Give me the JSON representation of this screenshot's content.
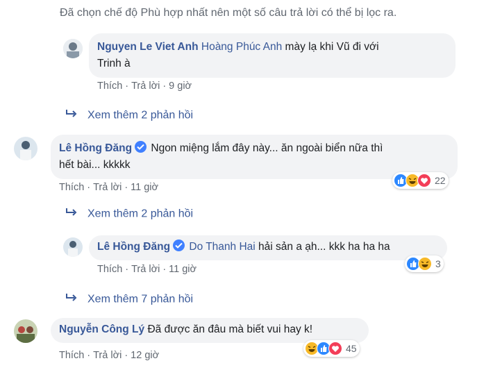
{
  "notice": "Đã chọn chế độ Phù hợp nhất nên một số câu trả lời có thể bị lọc ra.",
  "actions": {
    "like": "Thích",
    "reply": "Trả lời",
    "sep": "·"
  },
  "comments": [
    {
      "author": "Nguyen Le Viet Anh",
      "mention": "Hoàng Phúc Anh",
      "text_line1": "mày lạ khi Vũ đi với",
      "text_line2": "Trinh à",
      "time": "9 giờ"
    },
    {
      "author": "Lê Hồng Đăng",
      "mention": "",
      "text_line1": "Ngon miệng lắm đây này... ăn ngoài biển nữa thì",
      "text_line2": "hết bài... kkkkk",
      "time": "11 giờ",
      "reaction_count": "22",
      "reactions": [
        "like-icon",
        "haha-icon",
        "love-icon"
      ]
    },
    {
      "author": "Lê Hồng Đăng",
      "mention": "Do Thanh Hai",
      "text_line1": "hải sản a ạh... kkk ha ha ha",
      "time": "11 giờ",
      "reaction_count": "3",
      "reactions": [
        "like-icon",
        "haha-icon"
      ]
    },
    {
      "author": "Nguyễn Công Lý",
      "mention": "",
      "text_line1": "Đã được ăn đâu mà biết vui hay k!",
      "time": "12 giờ",
      "reaction_count": "45",
      "reactions": [
        "haha-icon",
        "like-icon",
        "love-icon"
      ]
    }
  ],
  "more_replies": [
    "Xem thêm 2 phản hồi",
    "Xem thêm 2 phản hồi",
    "Xem thêm 7 phản hồi"
  ],
  "colors": {
    "link": "#385898",
    "bubble": "#f2f3f5",
    "muted": "#606770",
    "like": "#2d88ff",
    "haha": "#f7b928",
    "love": "#f33e58"
  }
}
